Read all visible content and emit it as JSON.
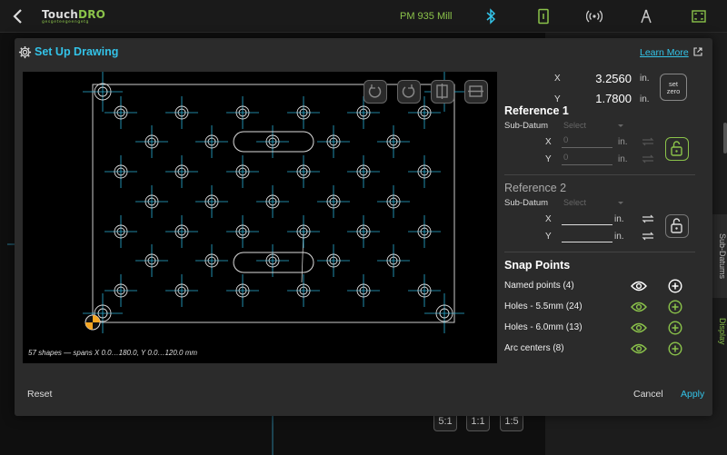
{
  "app": {
    "logo_text": "Touch",
    "logo_dro": "DRO",
    "logo_subtitle": "gesgeteegeengetg",
    "machine_name": "PM 935 Mill"
  },
  "side_tabs": [
    "Sub-Datums",
    "Display"
  ],
  "zoom_buttons": [
    "5:1",
    "1:1",
    "1:5"
  ],
  "dialog": {
    "title": "Set Up Drawing",
    "learn_more": "Learn More",
    "caption": "57 shapes — spans X 0.0…180.0, Y 0.0…120.0 mm",
    "position": {
      "x_label": "X",
      "x_value": "3.2560",
      "x_unit": "in.",
      "y_label": "Y",
      "y_value": "1.7800",
      "y_unit": "in.",
      "set_zero": [
        "set",
        "zero"
      ]
    },
    "reference1": {
      "title": "Reference 1",
      "sub_datum_label": "Sub-Datum",
      "select_placeholder": "Select",
      "x_label": "X",
      "x_value": "0",
      "x_unit": "in.",
      "y_label": "Y",
      "y_value": "0",
      "y_unit": "in."
    },
    "reference2": {
      "title": "Reference 2",
      "sub_datum_label": "Sub-Datum",
      "select_placeholder": "Select",
      "x_label": "X",
      "x_value": "",
      "x_unit": "in.",
      "y_label": "Y",
      "y_value": "",
      "y_unit": "in."
    },
    "snap_points": {
      "title": "Snap Points",
      "items": [
        {
          "label": "Named points (4)",
          "active": false
        },
        {
          "label": "Holes - 5.5mm (24)",
          "active": true
        },
        {
          "label": "Holes - 6.0mm (13)",
          "active": true
        },
        {
          "label": "Arc centers (8)",
          "active": true
        }
      ]
    },
    "reset": "Reset",
    "cancel": "Cancel",
    "apply": "Apply"
  },
  "colors": {
    "accent_cyan": "#33c3e8",
    "accent_green": "#8bc34a",
    "drawing_line": "#2ab0d6",
    "datum_yellow": "#f5a623"
  }
}
